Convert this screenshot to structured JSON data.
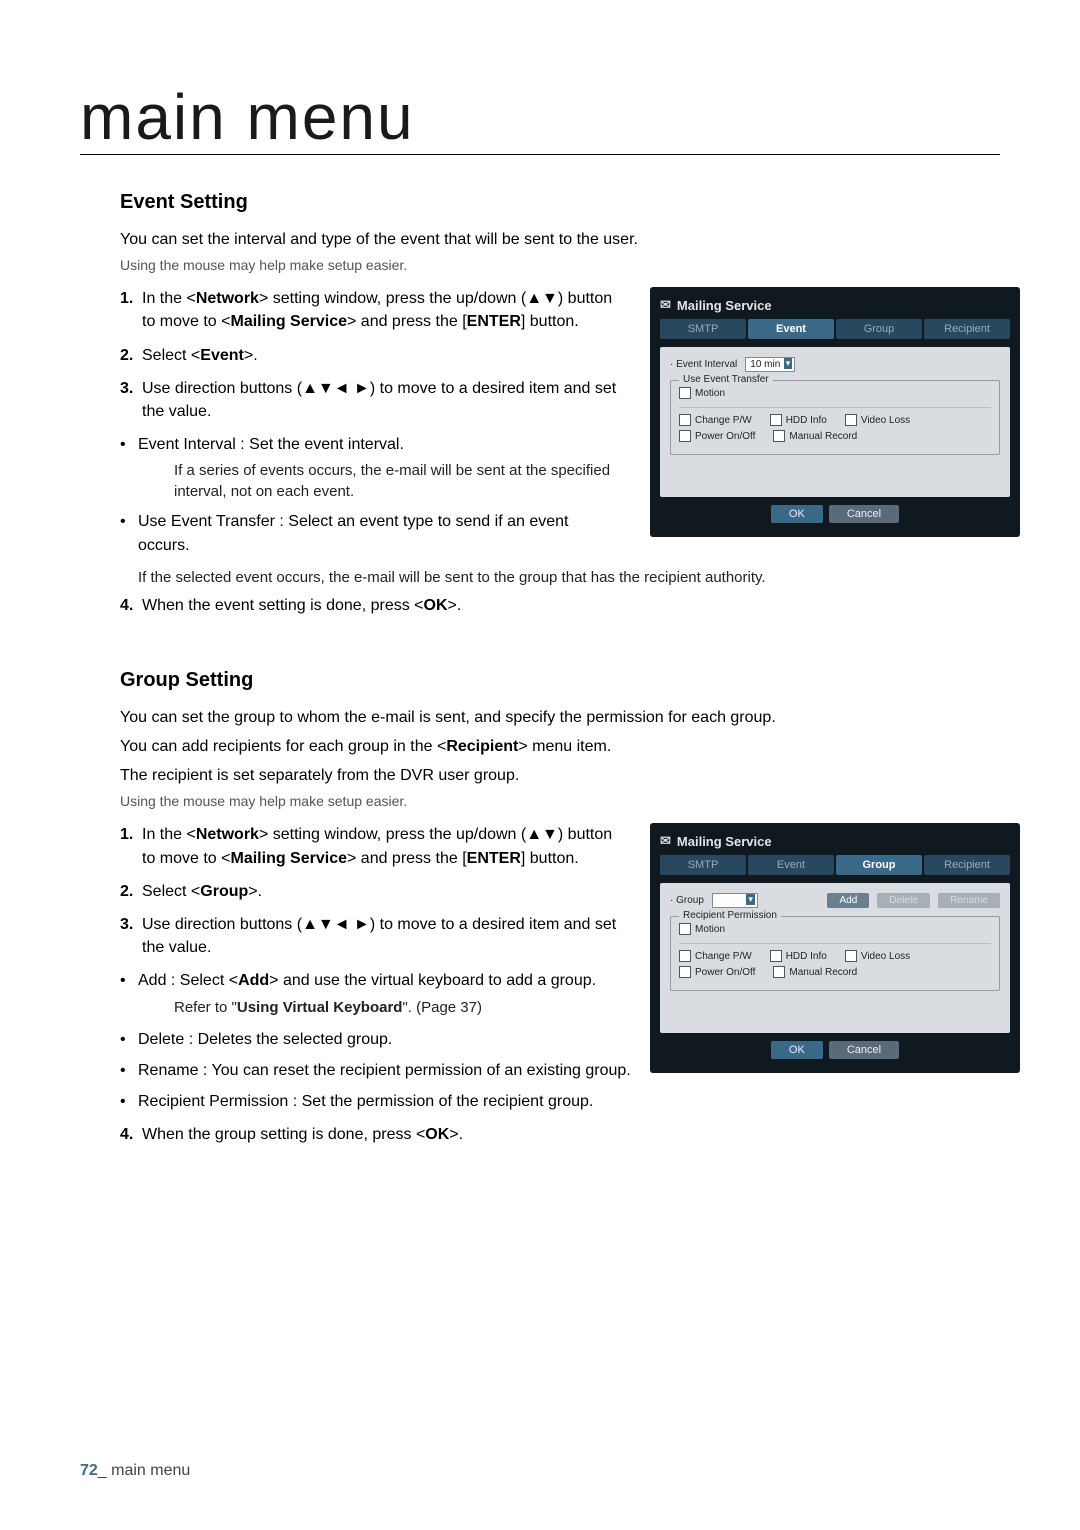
{
  "page": {
    "title": "main menu",
    "number": "72",
    "footer_label": "main menu"
  },
  "event": {
    "heading": "Event Setting",
    "intro": "You can set the interval and type of the event that will be sent to the user.",
    "mouse_note": "Using the mouse may help make setup easier.",
    "step1_a": "In the <",
    "step1_net": "Network",
    "step1_b": "> setting window, press the up/down (▲▼) button to move to <",
    "step1_ms": "Mailing Service",
    "step1_c": "> and press the [",
    "step1_enter": "ENTER",
    "step1_d": "] button.",
    "step2_a": "Select <",
    "step2_ev": "Event",
    "step2_b": ">.",
    "step3": "Use direction buttons (▲▼◄ ►) to move to a desired item and set the value.",
    "b1": "Event Interval : Set the event interval.",
    "b1_sub": "If a series of events occurs, the e-mail will be sent at the specified interval, not on each event.",
    "b2": "Use Event Transfer : Select an event type to send if an event occurs.",
    "b2_sub": "If the selected event occurs, the e-mail will be sent to the group that has the recipient authority.",
    "step4_a": "When the event setting is done, press <",
    "step4_ok": "OK",
    "step4_b": ">."
  },
  "group": {
    "heading": "Group Setting",
    "intro1": "You can set the group to whom the e-mail is sent, and specify the permission for each group.",
    "intro2_a": "You can add recipients for each group in the <",
    "intro2_rec": "Recipient",
    "intro2_b": "> menu item.",
    "intro3": "The recipient is set separately from the DVR user group.",
    "mouse_note": "Using the mouse may help make setup easier.",
    "step1_a": "In the <",
    "step1_net": "Network",
    "step1_b": "> setting window, press the up/down (▲▼) button to move to <",
    "step1_ms": "Mailing Service",
    "step1_c": "> and press the [",
    "step1_enter": "ENTER",
    "step1_d": "] button.",
    "step2_a": "Select <",
    "step2_grp": "Group",
    "step2_b": ">.",
    "step3": "Use direction buttons (▲▼◄ ►) to move to a desired item and set the value.",
    "b_add_a": "Add : Select <",
    "b_add_add": "Add",
    "b_add_b": "> and use the virtual keyboard to add a group.",
    "b_add_sub_a": "Refer to \"",
    "b_add_sub_bold": "Using Virtual Keyboard",
    "b_add_sub_b": "\". (Page 37)",
    "b_delete": "Delete : Deletes the selected group.",
    "b_rename": "Rename : You can reset the recipient permission of an existing group.",
    "b_perm": "Recipient Permission : Set the permission of the recipient group.",
    "step4_a": "When the group setting is done, press <",
    "step4_ok": "OK",
    "step4_b": ">."
  },
  "shot_event": {
    "title": "Mailing Service",
    "tabs": {
      "smtp": "SMTP",
      "event": "Event",
      "group": "Group",
      "recipient": "Recipient"
    },
    "interval_label": "Event Interval",
    "interval_value": "10 min",
    "transfer_legend": "Use Event Transfer",
    "chk_motion": "Motion",
    "chk_change": "Change P/W",
    "chk_hdd": "HDD Info",
    "chk_video": "Video Loss",
    "chk_power": "Power On/Off",
    "chk_manual": "Manual Record",
    "ok": "OK",
    "cancel": "Cancel"
  },
  "shot_group": {
    "title": "Mailing Service",
    "tabs": {
      "smtp": "SMTP",
      "event": "Event",
      "group": "Group",
      "recipient": "Recipient"
    },
    "group_label": "Group",
    "add": "Add",
    "delete": "Delete",
    "rename": "Rename",
    "perm_legend": "Recipient Permission",
    "chk_motion": "Motion",
    "chk_change": "Change P/W",
    "chk_hdd": "HDD Info",
    "chk_video": "Video Loss",
    "chk_power": "Power On/Off",
    "chk_manual": "Manual Record",
    "ok": "OK",
    "cancel": "Cancel"
  }
}
